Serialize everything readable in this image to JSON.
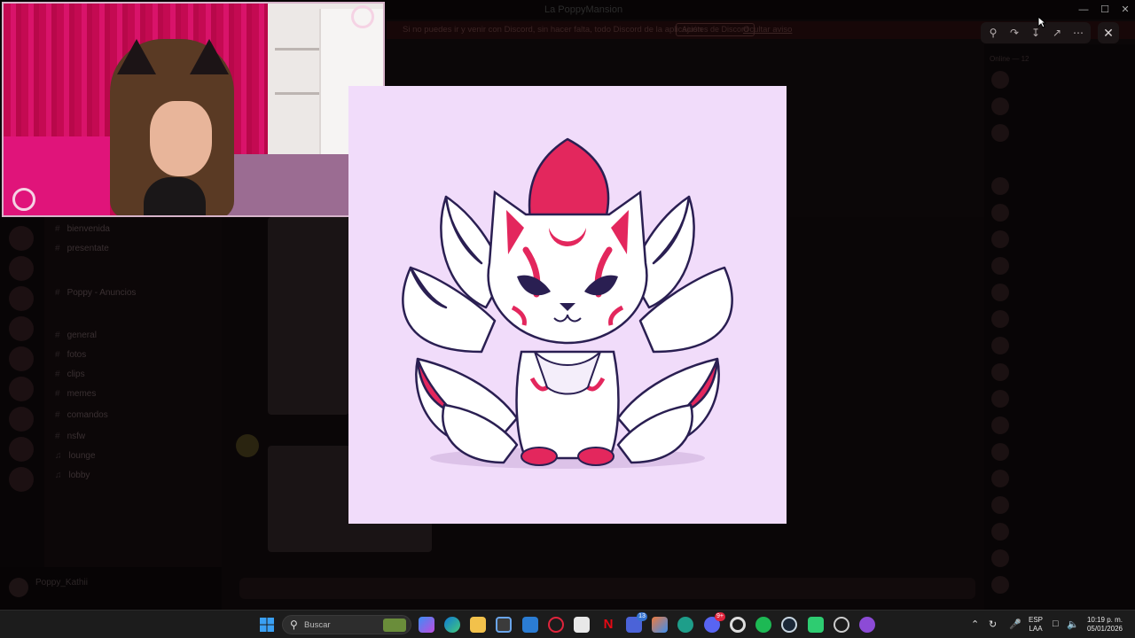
{
  "window": {
    "title": "La PoppyMansion"
  },
  "notice": {
    "text": "Si no puedes ir y venir con Discord, sin hacer falta, todo Discord de la aplicación",
    "button_label": "Ajustes de Discord",
    "link_label": "Ocultar aviso"
  },
  "channels": [
    {
      "label": "bienvenida",
      "kind": "text"
    },
    {
      "label": "presentate",
      "kind": "text"
    },
    {
      "label": "Poppy - Anuncios",
      "kind": "text"
    },
    {
      "label": "general",
      "kind": "text"
    },
    {
      "label": "fotos",
      "kind": "text"
    },
    {
      "label": "clips",
      "kind": "text"
    },
    {
      "label": "memes",
      "kind": "text"
    },
    {
      "label": "comandos",
      "kind": "text"
    },
    {
      "label": "nsfw",
      "kind": "text"
    },
    {
      "label": "lounge",
      "kind": "voice"
    },
    {
      "label": "lobby",
      "kind": "voice"
    }
  ],
  "user": {
    "name": "Poppy_Kathii"
  },
  "members_header": "Online — 12",
  "viewer": {
    "image_alt": "Kitsune nine-tailed fox with red mask markings"
  },
  "taskbar": {
    "search_placeholder": "Buscar",
    "badges": {
      "teams": "13",
      "discord": "9+"
    },
    "lang_top": "ESP",
    "lang_bottom": "LAA",
    "time": "10:19 p. m.",
    "date": "05/01/2026"
  },
  "colors": {
    "lightbox_bg": "#f1dcfa",
    "fox_accent": "#e3275d",
    "fox_outline": "#2a1f52",
    "taskbar_bg": "#1c1c1c",
    "accent_blue": "#3573d1"
  }
}
